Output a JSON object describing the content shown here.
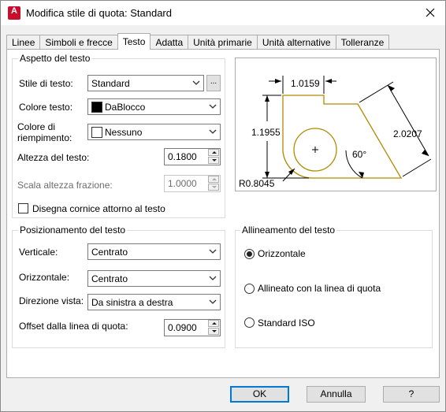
{
  "window": {
    "title": "Modifica stile di quota: Standard",
    "app_icon_letter": "A"
  },
  "tabs": [
    "Linee",
    "Simboli e frecce",
    "Testo",
    "Adatta",
    "Unità primarie",
    "Unità alternative",
    "Tolleranze"
  ],
  "aspetto": {
    "legend": "Aspetto del testo",
    "stile_label": "Stile di testo:",
    "stile_value": "Standard",
    "stile_btn": "...",
    "colore_label": "Colore testo:",
    "colore_value": "DaBlocco",
    "riemp_label_1": "Colore di",
    "riemp_label_2": "riempimento:",
    "riemp_value": "Nessuno",
    "altezza_label": "Altezza del testo:",
    "altezza_value": "0.1800",
    "scala_label": "Scala altezza frazione:",
    "scala_value": "1.0000",
    "cornice_label": "Disegna cornice attorno al testo"
  },
  "posizionamento": {
    "legend": "Posizionamento del testo",
    "verticale_label": "Verticale:",
    "verticale_value": "Centrato",
    "orizzontale_label": "Orizzontale:",
    "orizzontale_value": "Centrato",
    "direzione_label": "Direzione vista:",
    "direzione_value": "Da sinistra a destra",
    "offset_label": "Offset dalla linea di quota:",
    "offset_value": "0.0900"
  },
  "allineamento": {
    "legend": "Allineamento del testo",
    "options": [
      "Orizzontale",
      "Allineato con la linea di quota",
      "Standard ISO"
    ],
    "selected": "Orizzontale"
  },
  "preview": {
    "dim_top": "1.0159",
    "dim_left": "1.1955",
    "dim_right": "2.0207",
    "angle": "60°",
    "radius": "R0.8045",
    "outline_color": "#b08a00"
  },
  "buttons": {
    "ok": "OK",
    "cancel": "Annulla",
    "help": "?"
  }
}
